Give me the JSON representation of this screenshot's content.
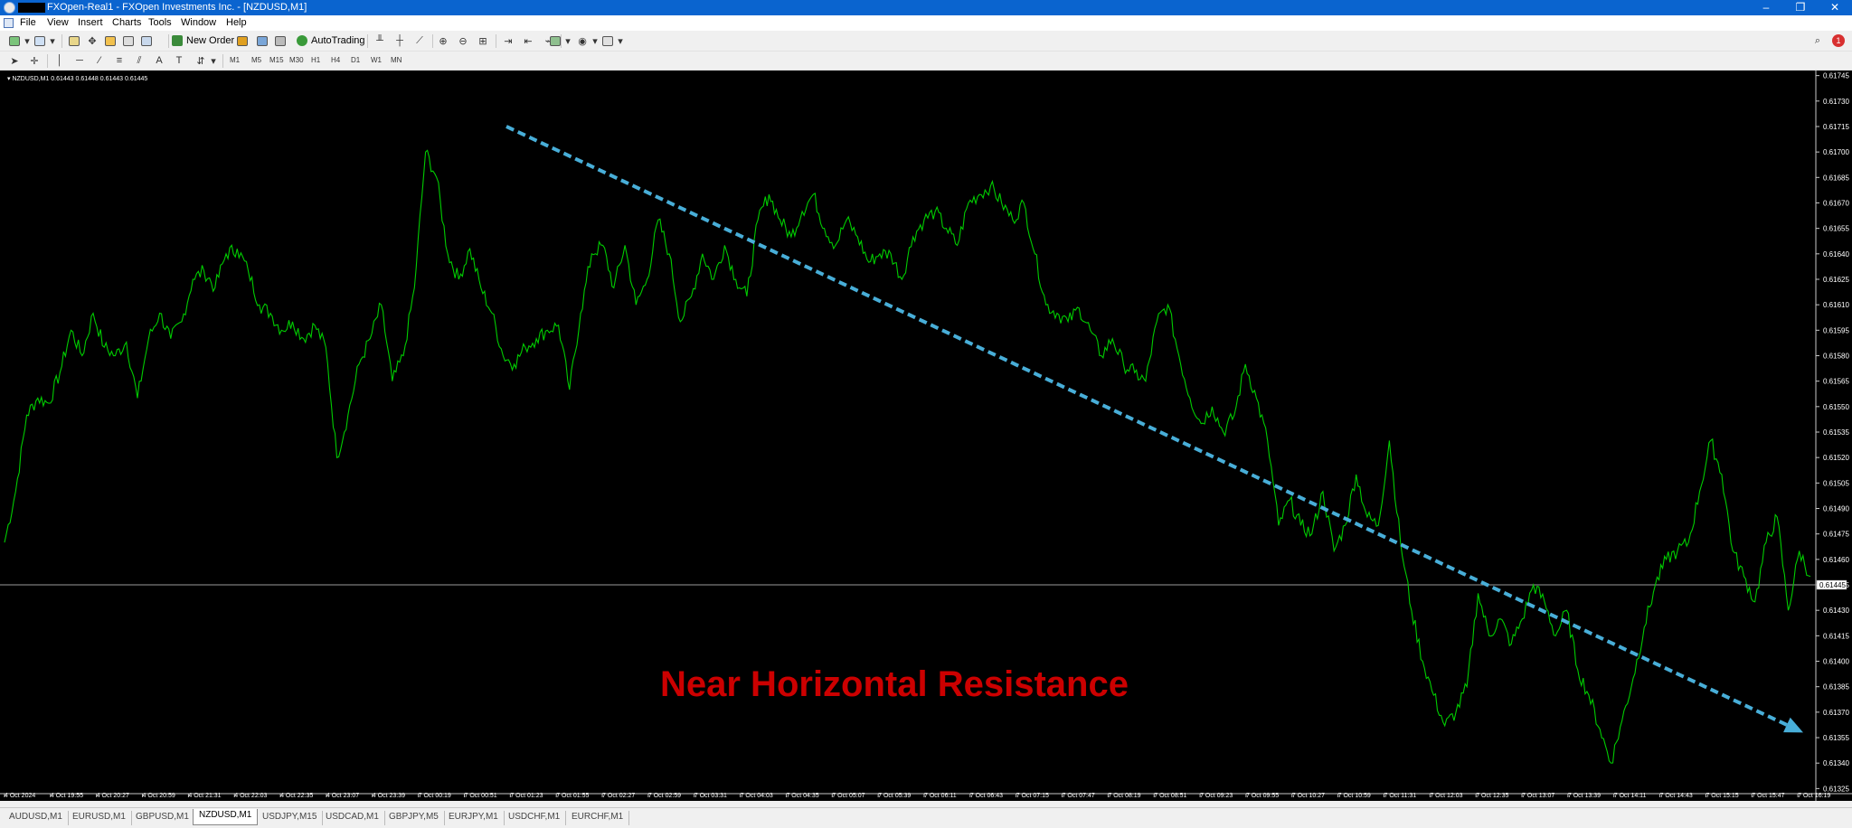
{
  "window": {
    "title": "FXOpen-Real1 - FXOpen Investments Inc. - [NZDUSD,M1]",
    "minimize": "–",
    "restore": "❐",
    "close": "✕"
  },
  "menu": [
    "File",
    "View",
    "Insert",
    "Charts",
    "Tools",
    "Window",
    "Help"
  ],
  "toolbar": {
    "new_order": "New Order",
    "autotrading": "AutoTrading",
    "timeframes": [
      "M1",
      "M5",
      "M15",
      "M30",
      "H1",
      "H4",
      "D1",
      "W1",
      "MN"
    ],
    "notification_count": "1",
    "text_tool": "A"
  },
  "chart": {
    "symbol_info": "NZDUSD,M1  0.61443 0.61448 0.61443 0.61445",
    "current_price": "0.61445",
    "annotation": "Near Horizontal Resistance",
    "colors": {
      "background": "#000000",
      "price_line": "#00cc00",
      "trendline": "#48aed8",
      "annotation": "#cc0000"
    }
  },
  "chart_data": {
    "type": "line",
    "symbol": "NZDUSD",
    "timeframe": "M1",
    "y_ticks": [
      "0.61745",
      "0.61730",
      "0.61715",
      "0.61700",
      "0.61685",
      "0.61670",
      "0.61655",
      "0.61640",
      "0.61625",
      "0.61610",
      "0.61595",
      "0.61580",
      "0.61565",
      "0.61550",
      "0.61535",
      "0.61520",
      "0.61505",
      "0.61490",
      "0.61475",
      "0.61460",
      "0.61445",
      "0.61430",
      "0.61415",
      "0.61400",
      "0.61385",
      "0.61370",
      "0.61355",
      "0.61340",
      "0.61325"
    ],
    "ylim": [
      0.61322,
      0.61748
    ],
    "x_ticks": [
      "4 Oct 2024",
      "4 Oct 19:55",
      "4 Oct 20:27",
      "4 Oct 20:59",
      "4 Oct 21:31",
      "4 Oct 22:03",
      "4 Oct 22:35",
      "4 Oct 23:07",
      "4 Oct 23:39",
      "7 Oct 00:19",
      "7 Oct 00:51",
      "7 Oct 01:23",
      "7 Oct 01:55",
      "7 Oct 02:27",
      "7 Oct 02:59",
      "7 Oct 03:31",
      "7 Oct 04:03",
      "7 Oct 04:35",
      "7 Oct 05:07",
      "7 Oct 05:39",
      "7 Oct 06:11",
      "7 Oct 06:43",
      "7 Oct 07:15",
      "7 Oct 07:47",
      "7 Oct 08:19",
      "7 Oct 08:51",
      "7 Oct 09:23",
      "7 Oct 09:55",
      "7 Oct 10:27",
      "7 Oct 10:59",
      "7 Oct 11:31",
      "7 Oct 12:03",
      "7 Oct 12:35",
      "7 Oct 13:07",
      "7 Oct 13:39",
      "7 Oct 14:11",
      "7 Oct 14:43",
      "7 Oct 15:15",
      "7 Oct 15:47",
      "7 Oct 16:19"
    ],
    "price_series": [
      [
        0,
        0.6147
      ],
      [
        1,
        0.615
      ],
      [
        2,
        0.61545
      ],
      [
        3,
        0.61555
      ],
      [
        4,
        0.61552
      ],
      [
        5,
        0.6157
      ],
      [
        6,
        0.61595
      ],
      [
        7,
        0.6158
      ],
      [
        8,
        0.61605
      ],
      [
        9,
        0.61585
      ],
      [
        10,
        0.6158
      ],
      [
        11,
        0.61588
      ],
      [
        12,
        0.61555
      ],
      [
        13,
        0.6159
      ],
      [
        14,
        0.61605
      ],
      [
        15,
        0.6159
      ],
      [
        16,
        0.616
      ],
      [
        17,
        0.61625
      ],
      [
        18,
        0.6163
      ],
      [
        19,
        0.6162
      ],
      [
        20,
        0.6164
      ],
      [
        21,
        0.61643
      ],
      [
        22,
        0.6163
      ],
      [
        23,
        0.6161
      ],
      [
        24,
        0.61605
      ],
      [
        25,
        0.61595
      ],
      [
        26,
        0.616
      ],
      [
        27,
        0.6159
      ],
      [
        28,
        0.61598
      ],
      [
        29,
        0.61585
      ],
      [
        30,
        0.6152
      ],
      [
        31,
        0.61545
      ],
      [
        32,
        0.61575
      ],
      [
        33,
        0.6159
      ],
      [
        34,
        0.6161
      ],
      [
        35,
        0.61565
      ],
      [
        36,
        0.6158
      ],
      [
        37,
        0.6162
      ],
      [
        38,
        0.617
      ],
      [
        39,
        0.61685
      ],
      [
        40,
        0.6164
      ],
      [
        41,
        0.61625
      ],
      [
        42,
        0.61643
      ],
      [
        43,
        0.6162
      ],
      [
        44,
        0.61605
      ],
      [
        45,
        0.6158
      ],
      [
        46,
        0.61575
      ],
      [
        47,
        0.61585
      ],
      [
        48,
        0.6159
      ],
      [
        49,
        0.61595
      ],
      [
        50,
        0.61598
      ],
      [
        51,
        0.6156
      ],
      [
        52,
        0.61605
      ],
      [
        53,
        0.6164
      ],
      [
        54,
        0.61645
      ],
      [
        55,
        0.6162
      ],
      [
        56,
        0.61645
      ],
      [
        57,
        0.6161
      ],
      [
        58,
        0.61625
      ],
      [
        59,
        0.6166
      ],
      [
        60,
        0.6164
      ],
      [
        61,
        0.616
      ],
      [
        62,
        0.61615
      ],
      [
        63,
        0.6164
      ],
      [
        64,
        0.61625
      ],
      [
        65,
        0.61645
      ],
      [
        66,
        0.61625
      ],
      [
        67,
        0.61615
      ],
      [
        68,
        0.6166
      ],
      [
        69,
        0.61675
      ],
      [
        70,
        0.6166
      ],
      [
        71,
        0.6165
      ],
      [
        72,
        0.61665
      ],
      [
        73,
        0.61675
      ],
      [
        74,
        0.61655
      ],
      [
        75,
        0.61645
      ],
      [
        76,
        0.6166
      ],
      [
        77,
        0.6165
      ],
      [
        78,
        0.61635
      ],
      [
        79,
        0.6164
      ],
      [
        80,
        0.6164
      ],
      [
        81,
        0.61625
      ],
      [
        82,
        0.6165
      ],
      [
        83,
        0.6166
      ],
      [
        84,
        0.61665
      ],
      [
        85,
        0.61655
      ],
      [
        86,
        0.61645
      ],
      [
        87,
        0.6167
      ],
      [
        88,
        0.61675
      ],
      [
        89,
        0.6168
      ],
      [
        90,
        0.6167
      ],
      [
        91,
        0.6166
      ],
      [
        92,
        0.6167
      ],
      [
        93,
        0.6164
      ],
      [
        94,
        0.6161
      ],
      [
        95,
        0.61605
      ],
      [
        96,
        0.616
      ],
      [
        97,
        0.61608
      ],
      [
        98,
        0.61595
      ],
      [
        99,
        0.6158
      ],
      [
        100,
        0.6159
      ],
      [
        101,
        0.61575
      ],
      [
        102,
        0.6157
      ],
      [
        103,
        0.61565
      ],
      [
        104,
        0.616
      ],
      [
        105,
        0.6161
      ],
      [
        106,
        0.6158
      ],
      [
        107,
        0.61555
      ],
      [
        108,
        0.6154
      ],
      [
        109,
        0.6155
      ],
      [
        110,
        0.61535
      ],
      [
        111,
        0.61545
      ],
      [
        112,
        0.61575
      ],
      [
        113,
        0.61555
      ],
      [
        114,
        0.6153
      ],
      [
        115,
        0.6148
      ],
      [
        116,
        0.61495
      ],
      [
        117,
        0.6148
      ],
      [
        118,
        0.61475
      ],
      [
        119,
        0.615
      ],
      [
        120,
        0.61465
      ],
      [
        121,
        0.6148
      ],
      [
        122,
        0.6151
      ],
      [
        123,
        0.61485
      ],
      [
        124,
        0.6148
      ],
      [
        125,
        0.6153
      ],
      [
        126,
        0.6147
      ],
      [
        127,
        0.6143
      ],
      [
        128,
        0.614
      ],
      [
        129,
        0.6138
      ],
      [
        130,
        0.61362
      ],
      [
        131,
        0.6137
      ],
      [
        132,
        0.61385
      ],
      [
        133,
        0.6144
      ],
      [
        134,
        0.61415
      ],
      [
        135,
        0.61425
      ],
      [
        136,
        0.6141
      ],
      [
        137,
        0.61425
      ],
      [
        138,
        0.61445
      ],
      [
        139,
        0.61435
      ],
      [
        140,
        0.61415
      ],
      [
        141,
        0.6143
      ],
      [
        142,
        0.61395
      ],
      [
        143,
        0.6138
      ],
      [
        144,
        0.6136
      ],
      [
        145,
        0.6134
      ],
      [
        146,
        0.61365
      ],
      [
        147,
        0.6139
      ],
      [
        148,
        0.6142
      ],
      [
        149,
        0.61445
      ],
      [
        150,
        0.6146
      ],
      [
        151,
        0.61465
      ],
      [
        152,
        0.6147
      ],
      [
        153,
        0.615
      ],
      [
        154,
        0.6153
      ],
      [
        155,
        0.6151
      ],
      [
        156,
        0.61465
      ],
      [
        157,
        0.6145
      ],
      [
        158,
        0.61435
      ],
      [
        159,
        0.6147
      ],
      [
        160,
        0.61485
      ],
      [
        161,
        0.6143
      ],
      [
        162,
        0.61465
      ],
      [
        163,
        0.6145
      ]
    ],
    "trendline": {
      "from": [
        "7 Oct 00:53",
        0.61715
      ],
      "to": [
        "7 Oct 16:19",
        0.61358
      ],
      "style": "dashed",
      "arrow": true
    },
    "current_price_line": 0.61445
  },
  "symbol_tabs": [
    "AUDUSD,M1",
    "EURUSD,M1",
    "GBPUSD,M1",
    "NZDUSD,M1",
    "USDJPY,M15",
    "USDCAD,M1",
    "GBPJPY,M5",
    "EURJPY,M1",
    "USDCHF,M1",
    "EURCHF,M1"
  ],
  "active_tab": "NZDUSD,M1"
}
